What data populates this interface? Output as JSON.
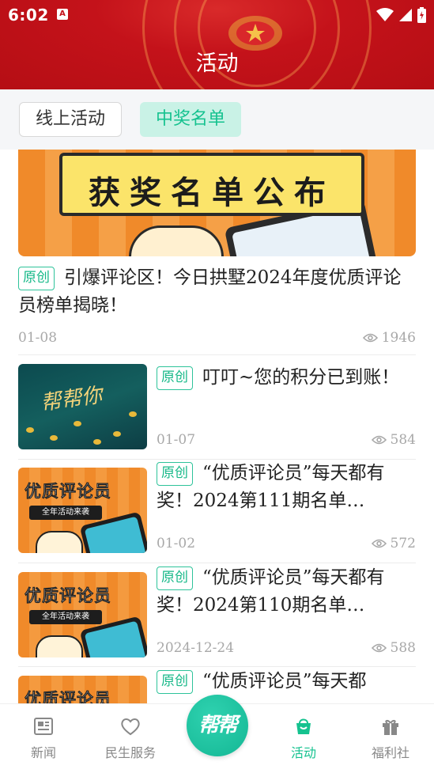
{
  "status_bar": {
    "time": "6:02",
    "a_badge": "A"
  },
  "header": {
    "title": "活动"
  },
  "tabs": [
    {
      "label": "线上活动",
      "active": false
    },
    {
      "label": "中奖名单",
      "active": true
    }
  ],
  "featured": {
    "banner_text": "获奖名单公布",
    "badge": "原创",
    "title": "引爆评论区！今日拱墅2024年度优质评论员榜单揭晓！",
    "date": "01-08",
    "views": "1946"
  },
  "items": [
    {
      "badge": "原创",
      "title": "叮叮~您的积分已到账！",
      "date": "01-07",
      "views": "584",
      "thumb_text": "帮帮你"
    },
    {
      "badge": "原创",
      "title": "“优质评论员”每天都有奖！2024第111期名单…",
      "date": "01-02",
      "views": "572",
      "thumb_title": "优质评论员",
      "thumb_pill": "全年活动来袭"
    },
    {
      "badge": "原创",
      "title": "“优质评论员”每天都有奖！2024第110期名单…",
      "date": "2024-12-24",
      "views": "588",
      "thumb_title": "优质评论员",
      "thumb_pill": "全年活动来袭"
    },
    {
      "badge": "原创",
      "title": "“优质评论员”每天都",
      "thumb_title": "优质评论员"
    }
  ],
  "nav": {
    "items": [
      {
        "label": "新闻",
        "icon": "newspaper-icon"
      },
      {
        "label": "民生服务",
        "icon": "heart-icon"
      },
      {
        "label": "活动",
        "icon": "activity-bag-icon",
        "active": true
      },
      {
        "label": "福利社",
        "icon": "gift-icon"
      }
    ],
    "center_label": "帮帮"
  },
  "colors": {
    "header_red": "#c4121a",
    "accent_green": "#15c28f",
    "tab_active_bg": "#c9f2e6"
  }
}
